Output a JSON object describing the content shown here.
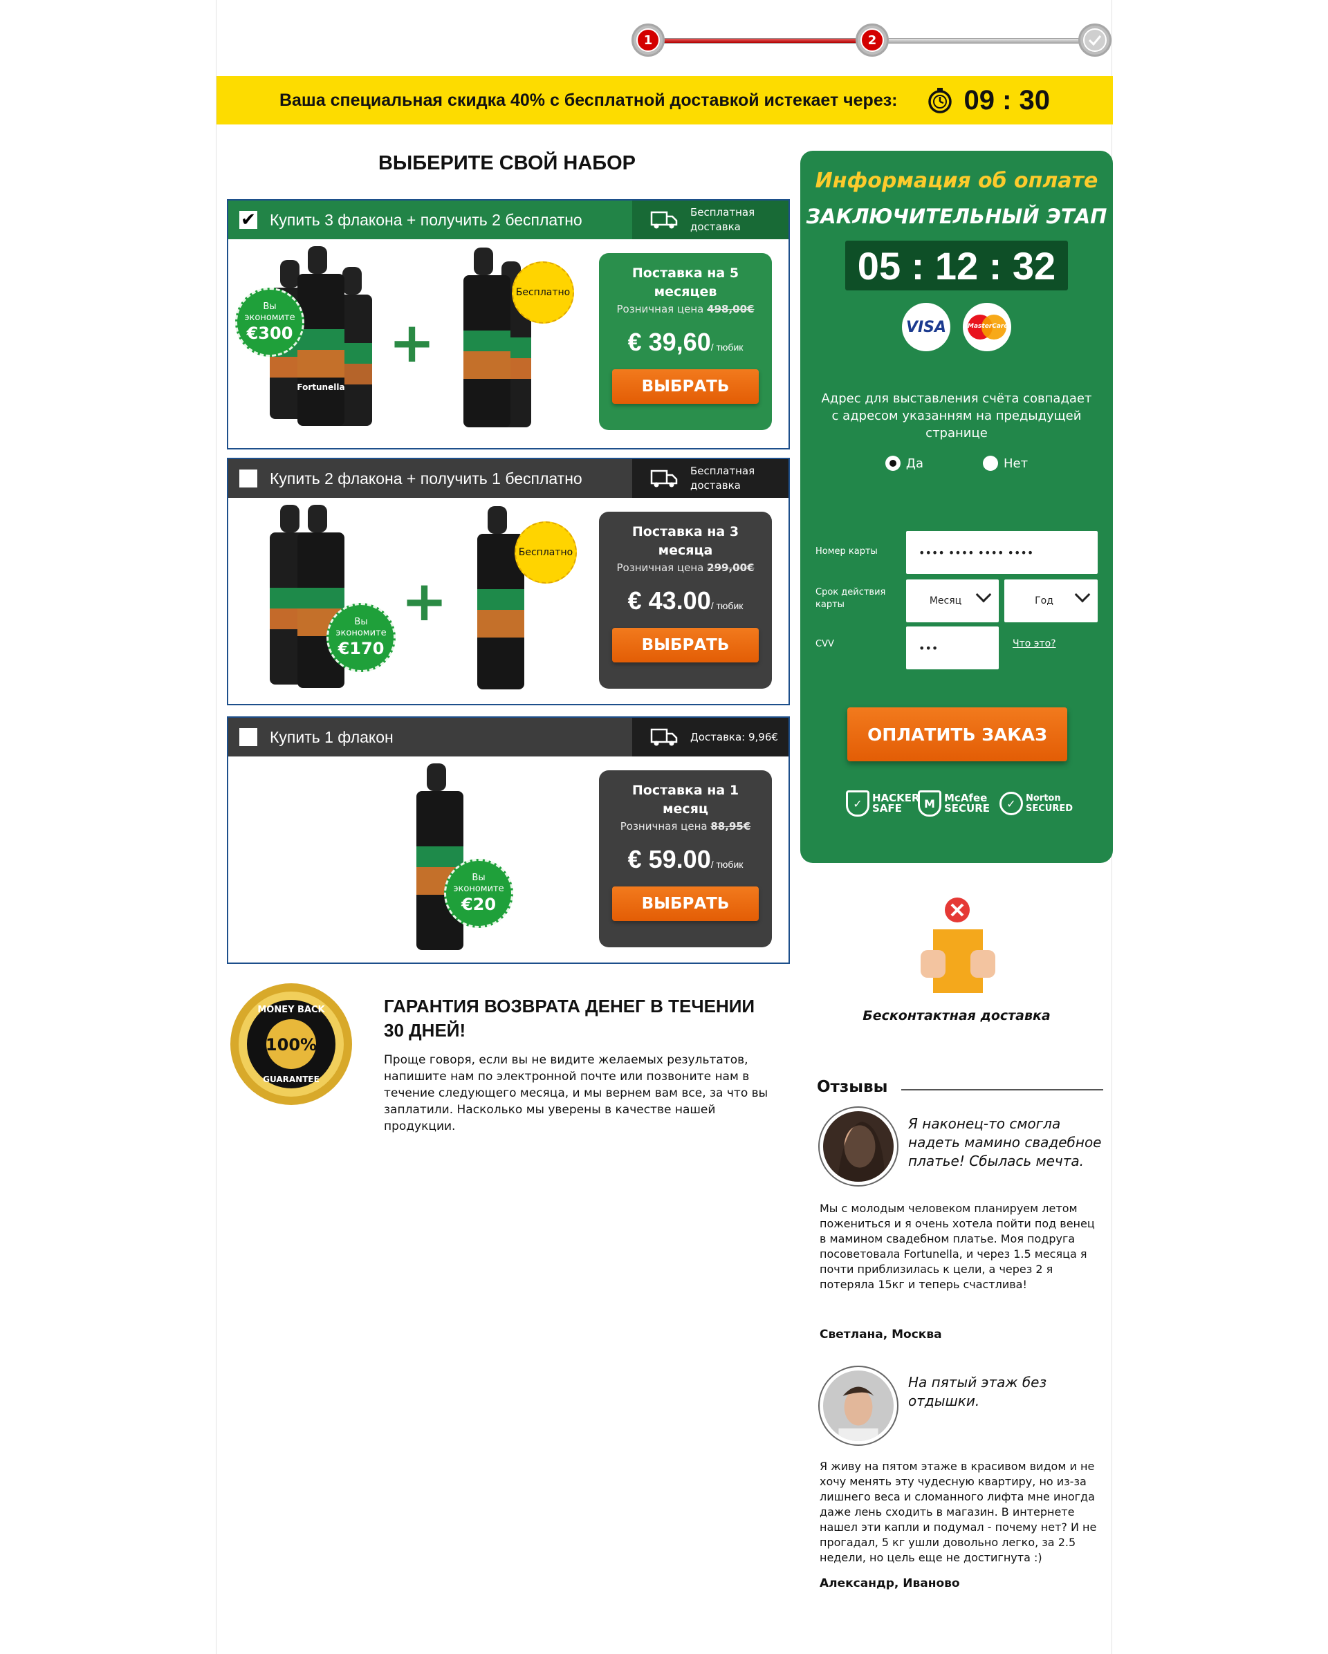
{
  "progress": {
    "steps": [
      "1",
      "2"
    ]
  },
  "banner": {
    "text": "Ваша специальная скидка 40% с бесплатной доставкой истекает через:",
    "timer": "09 : 30"
  },
  "section_title": "ВЫБЕРИТЕ СВОЙ НАБОР",
  "offers": [
    {
      "title": "Купить 3 флакона + получить 2 бесплатно",
      "shipping": "Бесплатная доставка",
      "save_label": "Вы экономите",
      "save_amount": "€300",
      "free_label": "Бесплатно",
      "price_title": "Поставка на 5 месяцев",
      "retail_label": "Розничная цена",
      "retail_price": "498,00€",
      "price": "€ 39,60",
      "per": "/ тюбик",
      "button": "ВЫБРАТЬ"
    },
    {
      "title": "Купить 2 флакона + получить 1 бесплатно",
      "shipping": "Бесплатная доставка",
      "save_label": "Вы экономите",
      "save_amount": "€170",
      "free_label": "Бесплатно",
      "price_title": "Поставка на 3 месяца",
      "retail_label": "Розничная цена",
      "retail_price": "299,00€",
      "price": "€ 43.00",
      "per": "/ тюбик",
      "button": "ВЫБРАТЬ"
    },
    {
      "title": "Купить 1 флакон",
      "shipping": "Доставка: 9,96€",
      "save_label": "Вы экономите",
      "save_amount": "€20",
      "price_title": "Поставка на 1 месяц",
      "retail_label": "Розничная цена",
      "retail_price": "88,95€",
      "price": "€ 59.00",
      "per": "/ тюбик",
      "button": "ВЫБРАТЬ"
    }
  ],
  "bottle_label": "Fortunella",
  "guarantee": {
    "seal_top": "MONEY BACK",
    "seal_pct": "100%",
    "seal_bottom": "GUARANTEE",
    "title": "ГАРАНТИЯ ВОЗВРАТА ДЕНЕГ В ТЕЧЕНИИ 30 ДНЕЙ!",
    "text": "Проще говоря, если вы не видите желаемых результатов, напишите нам по электронной почте или позвоните нам в течение следующего месяца, и мы вернем вам все, за что вы заплатили. Насколько мы уверены в качестве нашей продукции."
  },
  "payment": {
    "title": "Информация об оплате",
    "stage": "ЗАКЛЮЧИТЕЛЬНЫЙ ЭТАП",
    "timer": "05 : 12 : 32",
    "visa": "VISA",
    "mastercard": "MasterCard",
    "address_note": "Адрес для выставления счёта совпадает с адресом указанням на предыдущей странице",
    "radio_yes": "Да",
    "radio_no": "Нет",
    "card_label": "Номер карты",
    "card_value": "•••• •••• •••• ••••",
    "expiry_label": "Срок действия карты",
    "month": "Месяц",
    "year": "Год",
    "cvv_label": "CVV",
    "cvv_value": "•••",
    "whatis": "Что это?",
    "pay_button": "ОПЛАТИТЬ ЗАКАЗ",
    "badge_hacker": "HACKER SAFE",
    "badge_mcafee": "McAfee SECURE",
    "badge_norton": "Norton SECURED"
  },
  "contactless": "Бесконтактная доставка",
  "reviews": {
    "title": "Отзывы",
    "items": [
      {
        "quote": "Я наконец-то смогла надеть мамино свадебное платье! Сбылась мечта.",
        "text": "Мы с молодым человеком планируем летом пожениться и я очень хотела пойти под венец в маминoм свадебном платье. Моя подруга посоветовала Fortunella, и через 1.5 месяца я почти приблизилась к цели, а через 2 я потеряла 15кг и теперь счастлива!",
        "name": "Светлана, Москва"
      },
      {
        "quote": "На пятый этаж без отдышки.",
        "text": "Я живу на пятом этаже в красивом видом и не хочу менять эту чудесную квартиру, но из-за лишнего веса и сломанного лифта мне иногда даже лень сходить в магазин. В интернете нашел эти капли и подумал - почему нет? И не прогадал, 5 кг ушли довольно легко, за 2.5 недели, но цель еще не достигнута :)",
        "name": "Александр, Иваново"
      }
    ]
  }
}
